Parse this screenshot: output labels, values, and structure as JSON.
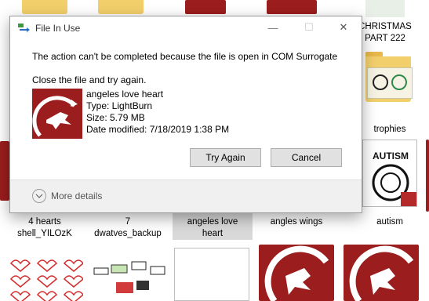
{
  "background": {
    "labels": {
      "christmas": "CHRISTMAS\nPART 222",
      "trophies": "trophies",
      "hearts": "4 hearts\nshell_YILOzK",
      "dwatves": "7\ndwatves_backup",
      "angeles": "angeles love\nheart",
      "wings": "angles wings",
      "autism": "autism"
    },
    "autism_art_text": "AUTISM"
  },
  "dialog": {
    "title": "File In Use",
    "message": "The action can't be completed because the file is open in COM Surrogate",
    "instruction": "Close the file and try again.",
    "file": {
      "name": "angeles love heart",
      "type": "Type: LightBurn",
      "size": "Size: 5.79 MB",
      "modified": "Date modified: 7/18/2019 1:38 PM"
    },
    "buttons": {
      "try_again": "Try Again",
      "cancel": "Cancel"
    },
    "more_details": "More details",
    "controls": {
      "minimize": "—",
      "maximize": "☐",
      "close": "✕"
    }
  },
  "colors": {
    "dragon_red": "#9c1d1d",
    "folder_yellow": "#f3cf6b",
    "dialog_bg": "#f0f0f0"
  }
}
